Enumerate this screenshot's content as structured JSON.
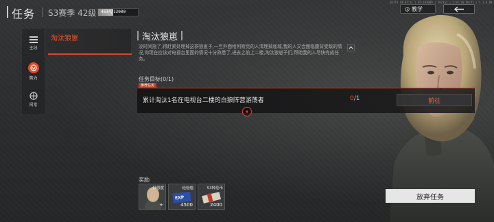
{
  "header": {
    "title": "任务",
    "season_level": "S3赛季  42级",
    "xp_text": "4634/12000",
    "xp_progress": 0.386,
    "status_line": "SO7T4 19:87:11  |  05:202009  |  2021S3  |  5:07:18:00:41  |  2.1.8.8B",
    "tutorial_label": "教学"
  },
  "nav": {
    "items": [
      {
        "label": "主线"
      },
      {
        "label": "势力"
      },
      {
        "label": "闯常"
      }
    ]
  },
  "quest_list": {
    "items": [
      {
        "name": "淘汰狼崽"
      }
    ]
  },
  "detail": {
    "title": "淘汰狼崽",
    "description": "没时间拖了,得赶紧处理掉这群狼崽子,一旦外面格列斯克的人清理掉底城,我的人又会面临腹背受敌的情况,你现在应该对电视台里面的情况十分熟悉了,进去之前上二楼,淘汰狼崽子们,帮助我的人尽快完成任务。",
    "objective_header": "任务目标(0/1)",
    "recommended_tag": "推荐任务",
    "objective": {
      "text": "累计淘汰1名在电视台二楼的白狼阵营游荡者",
      "progress_current": "0",
      "progress_total": "/1",
      "goto_label": "前往"
    }
  },
  "rewards": {
    "header": "奖励",
    "items": [
      {
        "label": "好感度",
        "count": "+",
        "icon": "portrait"
      },
      {
        "label": "经验值",
        "count": "4500",
        "icon": "exp-card"
      },
      {
        "label": "S3科伦币",
        "count": "2400",
        "icon": "cash-stack"
      }
    ]
  },
  "actions": {
    "abandon_label": "放弃任务"
  },
  "colors": {
    "accent": "#e0461f",
    "accent_text": "#e4562f"
  }
}
